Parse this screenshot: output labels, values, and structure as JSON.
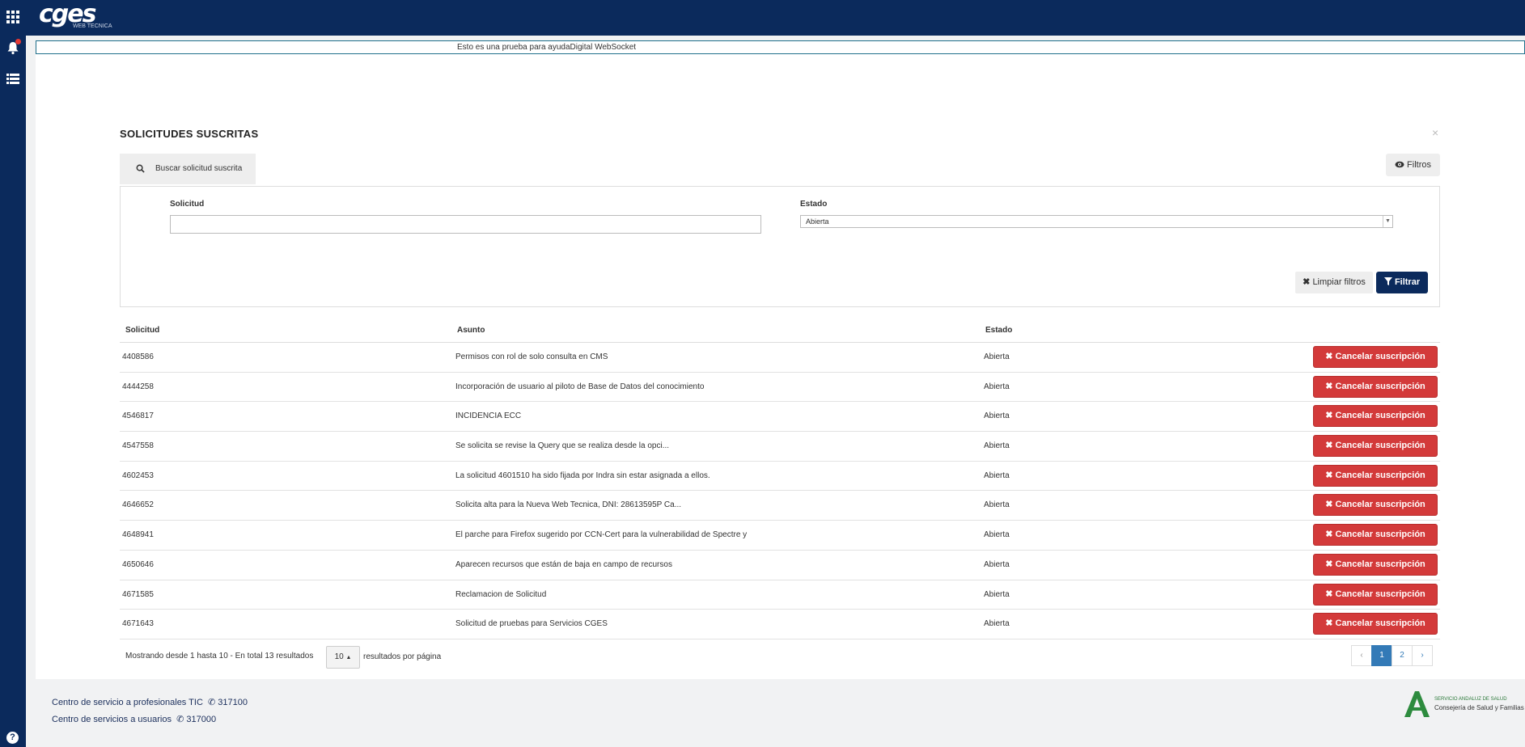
{
  "app": {
    "logo": "cges",
    "logo_sub": "WEB TECNICA"
  },
  "notice": "Esto es una prueba para ayudaDigital WebSocket",
  "panel": {
    "title": "SOLICITUDES SUSCRITAS",
    "close": "×",
    "search_tab": "Buscar solicitud suscrita",
    "filters_button": "Filtros"
  },
  "filters": {
    "solicitud_label": "Solicitud",
    "solicitud_value": "",
    "estado_label": "Estado",
    "estado_selected": "Abierta",
    "clear_button": "Limpiar filtros",
    "filter_button": "Filtrar"
  },
  "table": {
    "headers": [
      "Solicitud",
      "Asunto",
      "Estado"
    ],
    "cancel_label": "Cancelar suscripción",
    "rows": [
      {
        "id": "4408586",
        "asunto": "Permisos con rol de solo consulta en CMS",
        "estado": "Abierta"
      },
      {
        "id": "4444258",
        "asunto": "Incorporación de usuario al piloto de Base de Datos del conocimiento",
        "estado": "Abierta"
      },
      {
        "id": "4546817",
        "asunto": "INCIDENCIA ECC",
        "estado": "Abierta"
      },
      {
        "id": "4547558",
        "asunto": "Se solicita se revise la Query que se realiza desde la opci...",
        "estado": "Abierta"
      },
      {
        "id": "4602453",
        "asunto": "La solicitud 4601510 ha sido fijada por Indra sin estar asignada a ellos.",
        "estado": "Abierta"
      },
      {
        "id": "4646652",
        "asunto": "Solicita alta para la Nueva Web Tecnica, DNI: 28613595P Ca...",
        "estado": "Abierta"
      },
      {
        "id": "4648941",
        "asunto": "El parche para Firefox sugerido por CCN-Cert para la vulnerabilidad de Spectre y",
        "estado": "Abierta"
      },
      {
        "id": "4650646",
        "asunto": "Aparecen recursos que están de baja en campo de recursos",
        "estado": "Abierta"
      },
      {
        "id": "4671585",
        "asunto": "Reclamacion de Solicitud",
        "estado": "Abierta"
      },
      {
        "id": "4671643",
        "asunto": "Solicitud de pruebas para Servicios CGES",
        "estado": "Abierta"
      }
    ]
  },
  "pagination": {
    "info": "Mostrando desde 1 hasta 10 - En total 13 resultados",
    "per_page": "10",
    "per_page_label": "resultados por página",
    "prev": "‹",
    "pages": [
      "1",
      "2"
    ],
    "next": "›",
    "current_page": "1"
  },
  "footer": {
    "line1": "Centro de servicio a profesionales TIC",
    "phone1": "317100",
    "line2": "Centro de servicios a usuarios",
    "phone2": "317000",
    "org1": "SERVICIO ANDALUZ DE SALUD",
    "org2": "Consejería de Salud y Familias"
  },
  "colors": {
    "brand": "#0b2a5c",
    "danger": "#d33a3a",
    "link": "#337ab7"
  }
}
